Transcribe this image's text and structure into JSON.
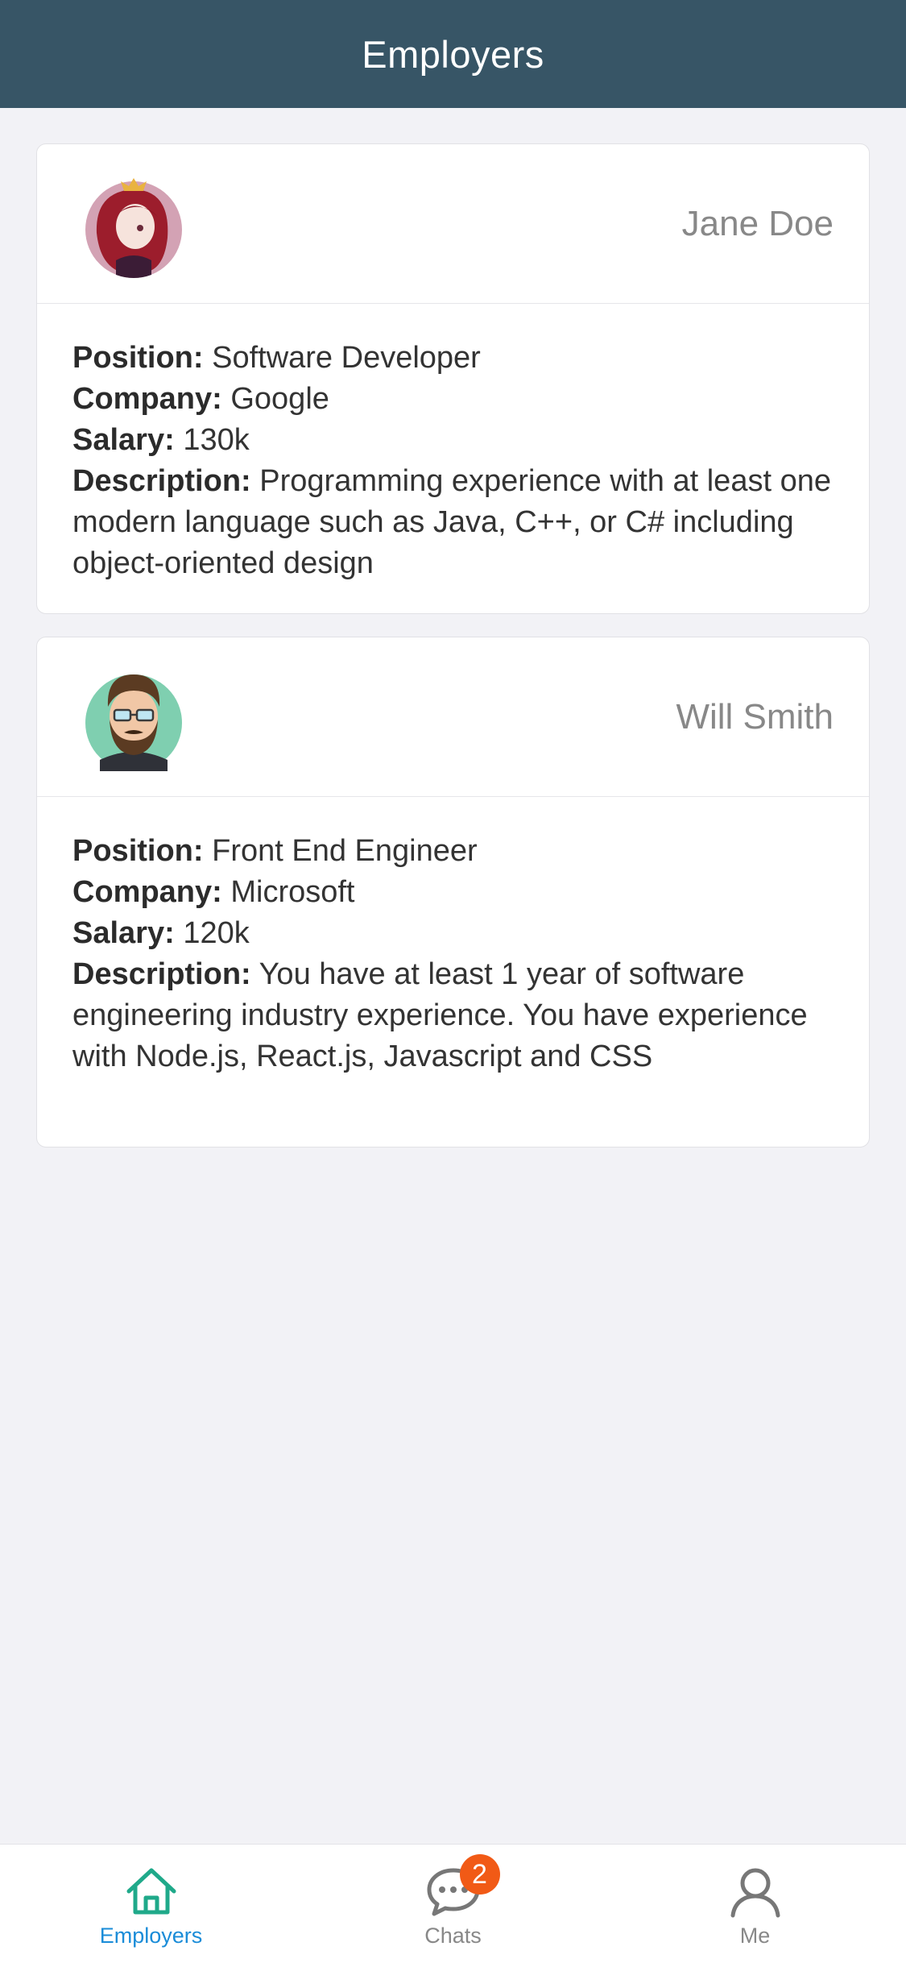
{
  "navbar": {
    "title": "Employers"
  },
  "employers": [
    {
      "name": "Jane Doe",
      "avatar_icon": "female-avatar-icon",
      "position_label": "Position:",
      "position": "Software Developer",
      "company_label": "Company:",
      "company": "Google",
      "salary_label": "Salary:",
      "salary": "130k",
      "description_label": "Description:",
      "description": "Programming experience with at least one modern language such as Java, C++, or C# including object-oriented design"
    },
    {
      "name": "Will Smith",
      "avatar_icon": "male-avatar-icon",
      "position_label": "Position:",
      "position": "Front End Engineer",
      "company_label": "Company:",
      "company": "Microsoft",
      "salary_label": "Salary:",
      "salary": "120k",
      "description_label": "Description:",
      "description": "You have at least 1 year of software engineering industry experience. You have experience with Node.js, React.js, Javascript and CSS"
    }
  ],
  "tabbar": {
    "tabs": [
      {
        "label": "Employers",
        "icon": "home-icon",
        "active": true
      },
      {
        "label": "Chats",
        "icon": "chat-icon",
        "badge": "2"
      },
      {
        "label": "Me",
        "icon": "user-icon"
      }
    ]
  },
  "colors": {
    "navbar": "#375566",
    "active_tab_label": "#1a8cd8",
    "active_tab_icon": "#1fa98a",
    "badge": "#f15a16",
    "background": "#f2f2f6"
  }
}
